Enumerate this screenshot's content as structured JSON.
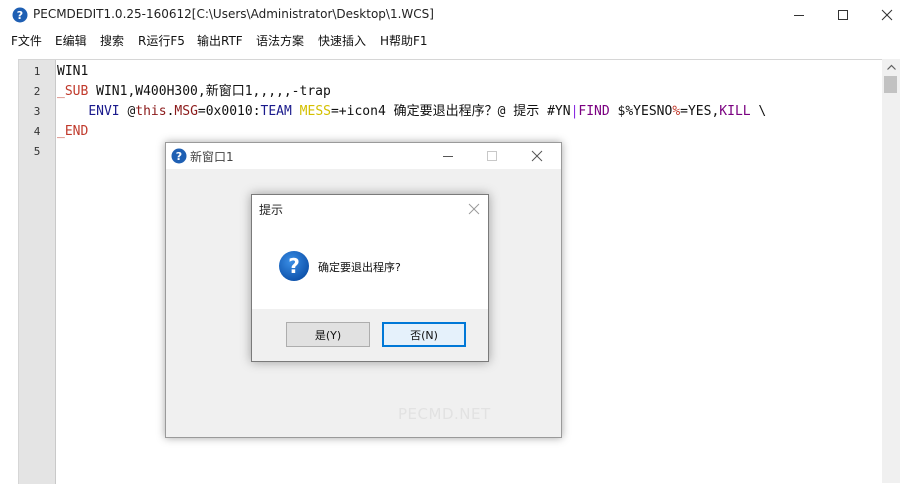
{
  "window": {
    "title": "PECMDEDIT1.0.25-160612[C:\\Users\\Administrator\\Desktop\\1.WCS]"
  },
  "menu": [
    {
      "label": "F文件"
    },
    {
      "label": "E编辑"
    },
    {
      "label": "搜索"
    },
    {
      "label": "R运行F5"
    },
    {
      "label": "输出RTF"
    },
    {
      "label": "语法方案"
    },
    {
      "label": "快速插入"
    },
    {
      "label": "H帮助F1"
    }
  ],
  "editor": {
    "line_numbers": [
      "1",
      "2",
      "3",
      "4",
      "5"
    ],
    "lines": {
      "l1": "WIN1",
      "l2_kw": "_SUB",
      "l2_rest": " WIN1,W400H300,新窗口1,,,,,-trap",
      "l3_indent": "    ",
      "l3_envi": "ENVI",
      "l3_at": " @",
      "l3_this": "this",
      "l3_dot": ".",
      "l3_msg": "MSG",
      "l3_eq": "=0x0010:",
      "l3_team": "TEAM",
      "l3_sp": " ",
      "l3_mess": "MESS",
      "l3_rest": "=+icon4 确定要退出程序？@ 提示 #YN",
      "l3_bar": "|",
      "l3_find": "FIND",
      "l3_var": " $%YESNO",
      "l3_pct": "%",
      "l3_yes": "=YES,",
      "l3_kill": "KILL",
      "l3_bs": " \\",
      "l4_kw": "_END"
    }
  },
  "child_window": {
    "title": "新窗口1",
    "watermark": "PECMD.NET"
  },
  "message_box": {
    "title": "提示",
    "message": "确定要退出程序?",
    "yes_label": "是(Y)",
    "no_label": "否(N)"
  }
}
